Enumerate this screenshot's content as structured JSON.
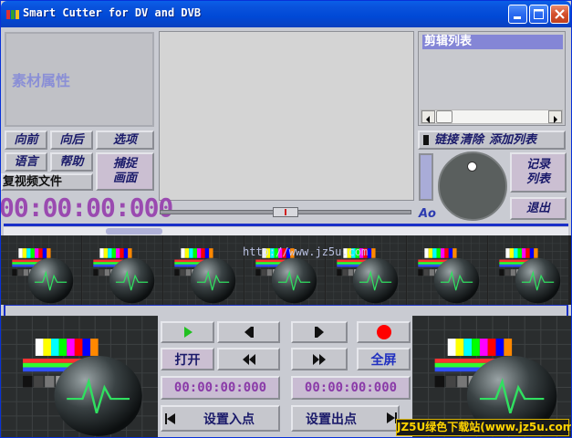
{
  "window": {
    "title": "Smart Cutter for DV and DVB"
  },
  "material": {
    "label": "素材属性"
  },
  "clip_list": {
    "title": "剪辑列表"
  },
  "nav": {
    "prev": "向前",
    "next": "向后",
    "options": "选项",
    "language": "语言",
    "help": "帮助",
    "capture": "捕捉画面",
    "repair_video": "复视频文件"
  },
  "clip_ops": {
    "link": "链接",
    "clear": "清除",
    "add_list": "添加列表"
  },
  "right_actions": {
    "record_list": "记录列表",
    "exit": "退出"
  },
  "timecode": {
    "main": "00:00:00:000",
    "in_point": "00:00:00:000",
    "out_point": "00:00:00:000"
  },
  "volume": {
    "label": "Ao"
  },
  "watermark": {
    "text": "http://www.jz5u.com"
  },
  "controls": {
    "open": "打开",
    "fullscreen": "全屏",
    "set_in": "设置入点",
    "set_out": "设置出点"
  },
  "banner": {
    "text": "JZ5U绿色下载站(www.jz5u.com)"
  },
  "colors": {
    "accent_blue": "#1a30c8",
    "timecode_purple": "#9a4ab0",
    "record_red": "#ff0000",
    "play_green": "#20c020"
  },
  "icons": {
    "play": "play-icon",
    "step_back": "step-back-icon",
    "step_forward": "step-forward-icon",
    "record": "record-icon",
    "rewind": "rewind-icon",
    "fast_forward": "fast-forward-icon",
    "to_start": "to-start-icon",
    "to_end": "to-end-icon"
  }
}
